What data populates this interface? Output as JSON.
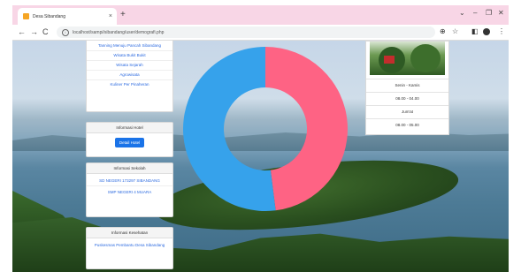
{
  "browser": {
    "tab_title": "Desa Sibandang",
    "tab_close": "×",
    "new_tab": "+",
    "url": "localhost/sampi/sibandang/user/demografi.php",
    "window_controls": [
      "⌄",
      "–",
      "❐",
      "✕"
    ],
    "nav": {
      "back": "←",
      "forward": "→",
      "reload": "C"
    },
    "toolbar_icons": [
      "⊕",
      "☆",
      "◧",
      "⋮"
    ]
  },
  "sidebar": {
    "top_links": [
      "Tanning Menuju Pancah Sibandang",
      "Wisata Bukit Bukit",
      "Wisata Sejarah",
      "Agrowisata",
      "Kuliner Per Pinaheran"
    ],
    "hotel_panel": {
      "header": "Informasi Hotel",
      "button": "Detail Hotel"
    },
    "school_panel": {
      "header": "Informasi Sekolah",
      "links": [
        "SD NEGERI 173297 SIBANDANG",
        "SMP NEGERI 4 MUARA"
      ]
    },
    "health_panel": {
      "header": "Informasi Kesehatan",
      "links": [
        "Puskesmas Pembantu Desa Sibandang"
      ]
    }
  },
  "schedule": {
    "rows": [
      "Senin - Kamis",
      "08.00 - 04.00",
      "Jum'at",
      "08.00 - 05.00"
    ]
  },
  "chart_data": {
    "type": "pie",
    "donut": true,
    "title": "",
    "series": [
      {
        "value": 48,
        "color": "#fe6384"
      },
      {
        "value": 52,
        "color": "#36a2eb"
      }
    ]
  }
}
